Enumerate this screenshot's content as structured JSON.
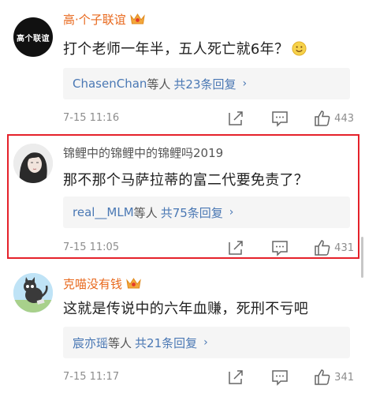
{
  "comments": [
    {
      "avatar_text": "高个联谊",
      "username": "高·个子联谊",
      "vip": true,
      "text": "打个老师一年半，五人死亡就6年？",
      "emoji": "smile-emoji",
      "reply_user": "ChasenChan",
      "reply_mid": "等人",
      "reply_count": "共23条回复",
      "time": "7-15 11:16",
      "likes": "443"
    },
    {
      "username": "锦鲤中的锦鲤中的锦鲤吗2019",
      "vip": false,
      "text": "那不那个马萨拉蒂的富二代要免责了？",
      "reply_user": "real__MLM",
      "reply_mid": "等人",
      "reply_count": "共75条回复",
      "time": "7-15 11:05",
      "likes": "431"
    },
    {
      "username": "克喵没有钱",
      "vip": true,
      "text": "这就是传说中的六年血赚，死刑不亏吧",
      "reply_user": "宸亦瑶",
      "reply_mid": "等人",
      "reply_count": "共21条回复",
      "time": "7-15 11:17",
      "likes": "341"
    }
  ],
  "icons": {
    "reply_chevron": "›",
    "share": "share-icon",
    "comment": "comment-icon",
    "like": "thumbs-up-icon"
  },
  "colors": {
    "username_orange": "#e8691e",
    "link_blue": "#4a78b4",
    "highlight_red": "#e5212a",
    "meta_gray": "#8d8d8d"
  }
}
